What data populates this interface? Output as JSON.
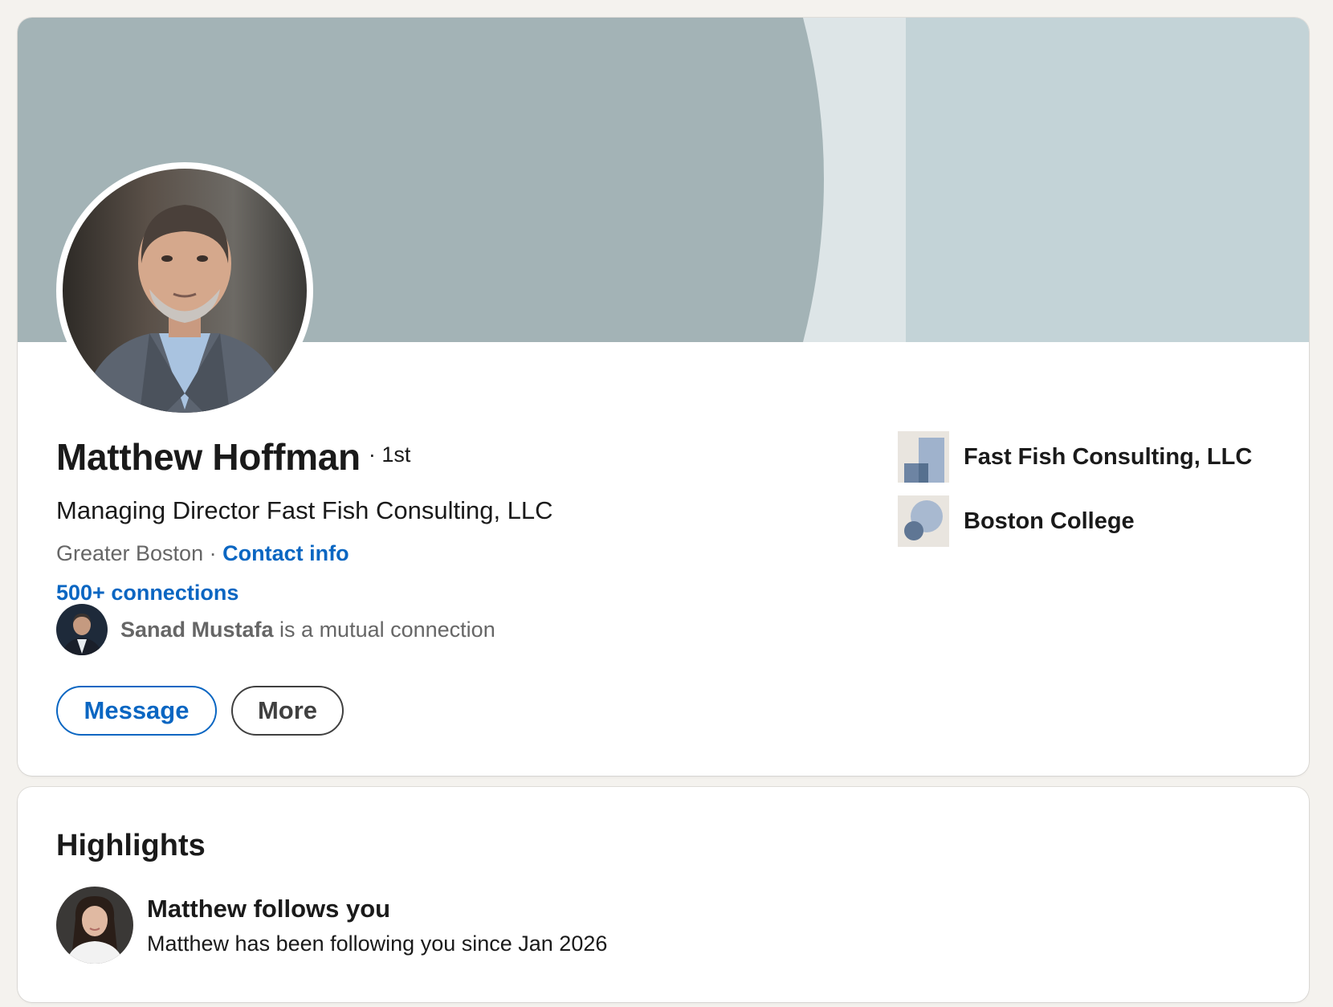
{
  "profile": {
    "name": "Matthew Hoffman",
    "degree": "· 1st",
    "headline": "Managing Director Fast Fish Consulting, LLC",
    "location": "Greater Boston",
    "separator": " · ",
    "contact_info_label": "Contact info",
    "connections_label": "500+ connections",
    "mutual": {
      "name": "Sanad Mustafa",
      "text": " is a mutual connection"
    },
    "buttons": {
      "message_label": "Message",
      "more_label": "More"
    },
    "organizations": [
      {
        "name": "Fast Fish Consulting, LLC",
        "logo_icon": "building-logo-icon"
      },
      {
        "name": "Boston College",
        "logo_icon": "school-logo-icon"
      }
    ]
  },
  "highlights": {
    "title": "Highlights",
    "item": {
      "heading": "Matthew follows you",
      "detail": "Matthew has been following you since Jan 2026"
    }
  },
  "colors": {
    "page_bg": "#f4f2ee",
    "link_blue": "#0a66c2",
    "banner_dark": "#a3b3b6",
    "banner_light": "#c3d3d7",
    "banner_mid": "#dde5e7"
  }
}
